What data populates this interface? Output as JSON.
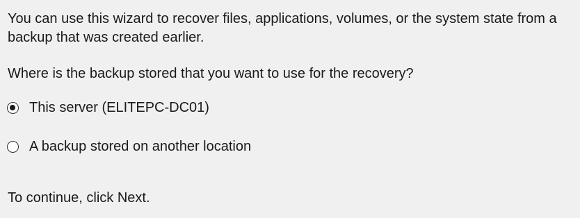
{
  "wizard": {
    "intro_text": "You can use this wizard to recover files, applications, volumes, or the system state from a backup that was created earlier.",
    "question": "Where is the backup stored that you want to use for the recovery?",
    "options": [
      {
        "label": "This server (ELITEPC-DC01)",
        "selected": true
      },
      {
        "label": "A backup stored on another location",
        "selected": false
      }
    ],
    "footer_text": "To continue, click Next."
  }
}
